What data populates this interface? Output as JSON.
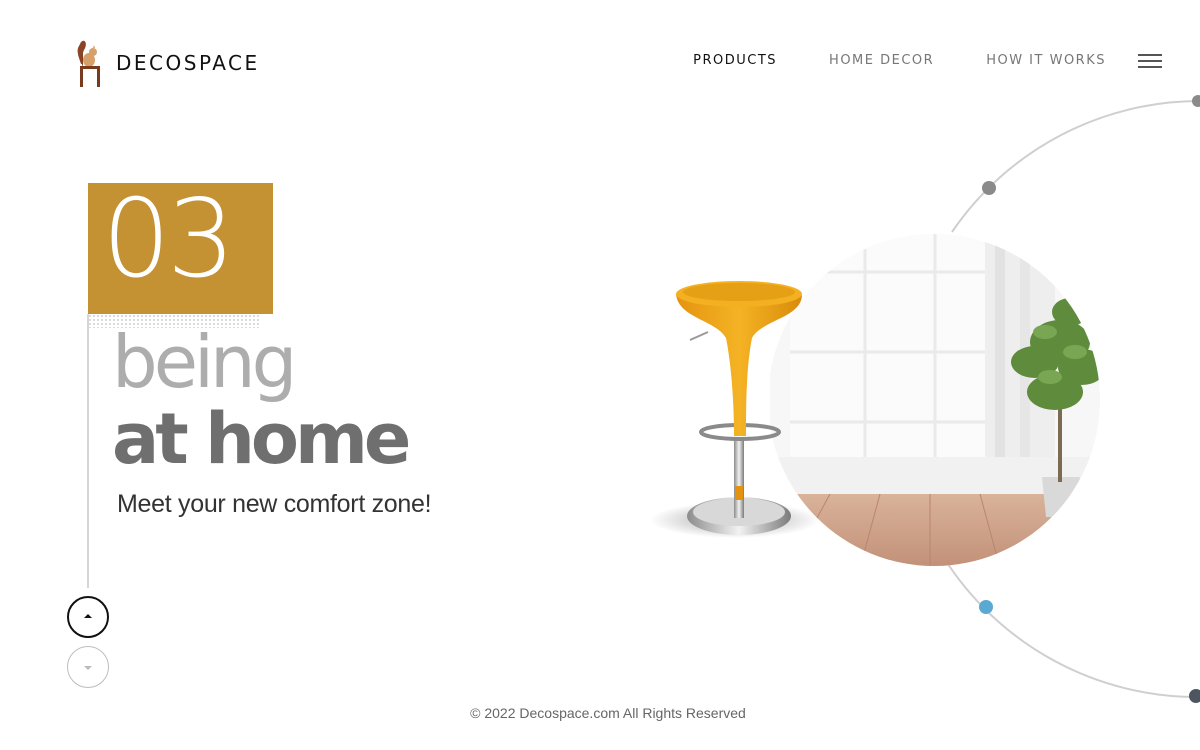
{
  "brand": {
    "name": "DECOSPACE",
    "icon": "squirrel-chair-logo-icon"
  },
  "nav": {
    "items": [
      {
        "label": "PRODUCTS",
        "active": true
      },
      {
        "label": "HOME DECOR",
        "active": false
      },
      {
        "label": "HOW IT WORKS",
        "active": false
      }
    ],
    "menu_icon": "hamburger-menu-icon"
  },
  "hero": {
    "slide_number": "03",
    "title_light": "being",
    "title_bold": "at home",
    "tagline": "Meet your new comfort zone!"
  },
  "slider_controls": {
    "up_icon": "arrow-up-icon",
    "down_icon": "arrow-down-icon"
  },
  "footer": {
    "copyright": "© 2022 Decospace.com All Rights Reserved"
  },
  "colors": {
    "accent": "#c49133",
    "stool": "#e9a41c",
    "orbit_dot_active": "#5aa9d3",
    "orbit_dot": "#888888"
  }
}
